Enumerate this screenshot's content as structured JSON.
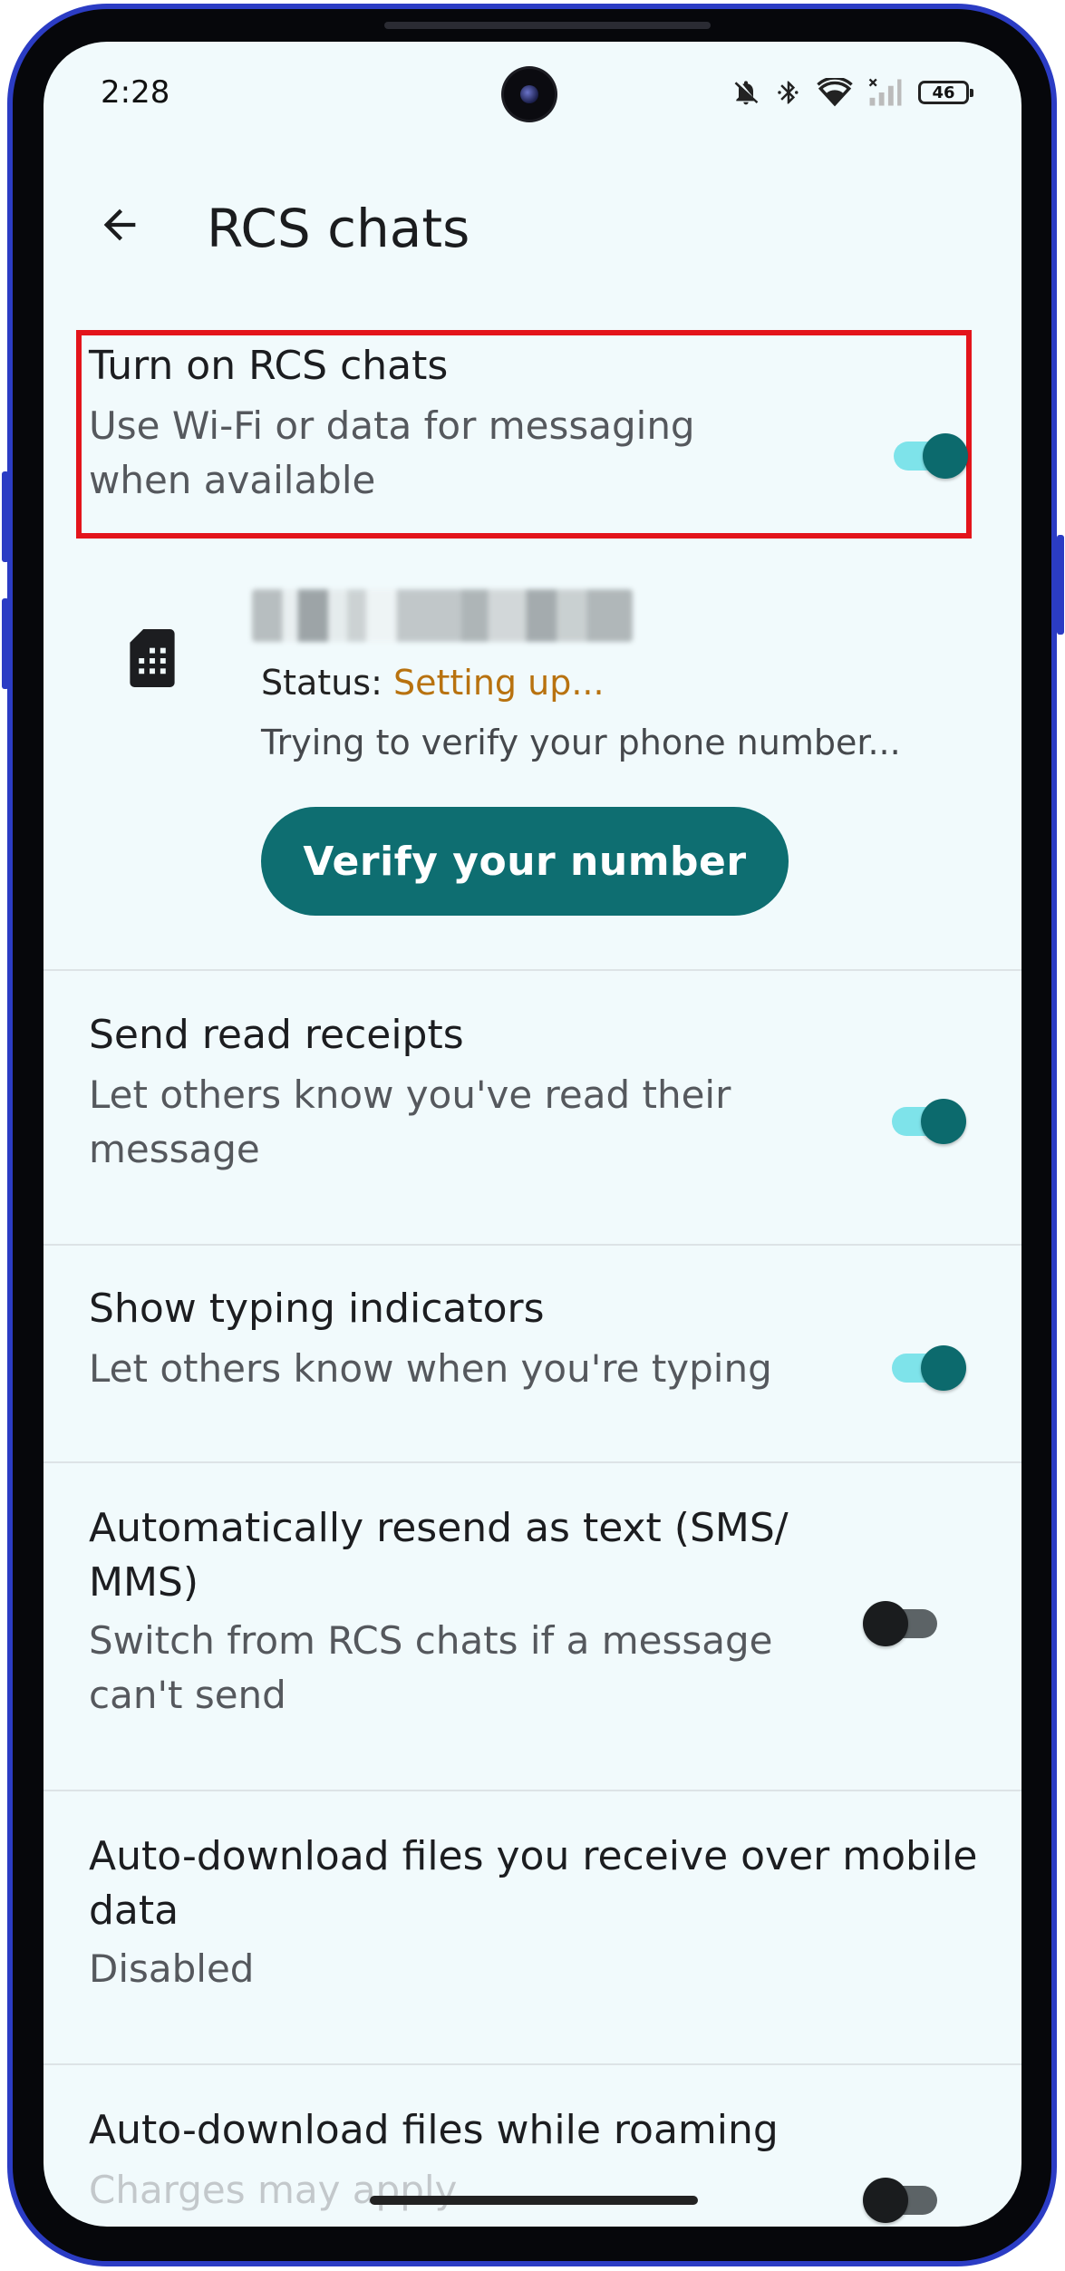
{
  "status_bar": {
    "time": "2:28",
    "battery": "46",
    "icons": [
      "notifications-off-icon",
      "bluetooth-icon",
      "wifi-icon",
      "signal-icon",
      "battery-icon"
    ]
  },
  "app_bar": {
    "title": "RCS chats",
    "back_icon": "arrow-back-icon"
  },
  "settings": {
    "rcs_toggle": {
      "title": "Turn on RCS chats",
      "subtitle_line1": "Use Wi-Fi or data for messaging",
      "subtitle_line2": "when available",
      "enabled": true
    },
    "sim": {
      "icon": "sim-card-icon",
      "status_label": "Status: ",
      "status_value": "Setting up...",
      "detail": "Trying to verify your phone number...",
      "verify_button": "Verify your number"
    },
    "read_receipts": {
      "title": "Send read receipts",
      "subtitle_line1": "Let others know you've read their",
      "subtitle_line2": "message",
      "enabled": true
    },
    "typing_indicators": {
      "title": "Show typing indicators",
      "subtitle": "Let others know when you're typing",
      "enabled": true
    },
    "auto_resend": {
      "title_line1": "Automatically resend as text (SMS/",
      "title_line2": "MMS)",
      "subtitle_line1": "Switch from RCS chats if a message",
      "subtitle_line2": "can't send",
      "enabled": false
    },
    "auto_download_mobile": {
      "title_line1": "Auto-download files you receive over mobile",
      "title_line2": "data",
      "subtitle": "Disabled"
    },
    "auto_download_roaming": {
      "title": "Auto-download files while roaming",
      "subtitle": "Charges may apply",
      "enabled": false
    }
  },
  "colors": {
    "accent": "#0e6e71",
    "highlight_box": "#e3141b",
    "status_setting_up": "#b8720f",
    "background": "#f1fafc"
  }
}
